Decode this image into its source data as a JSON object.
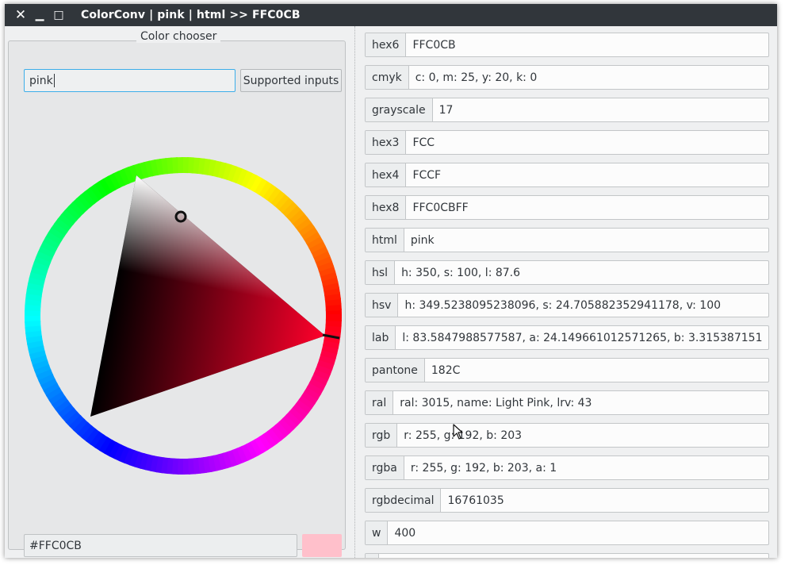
{
  "window": {
    "title": "ColorConv | pink | html >> FFC0CB",
    "close_glyph": "✕",
    "minimize_glyph": "▁",
    "maximize_glyph": "□"
  },
  "chooser": {
    "group_title": "Color chooser",
    "input_value": "pink",
    "supported_inputs_label": "Supported inputs",
    "hex_value": "#FFC0CB",
    "swatch_color": "#FFC0CB",
    "selected_hue_deg": 350
  },
  "formats": [
    {
      "label": "hex6",
      "value": "FFC0CB"
    },
    {
      "label": "cmyk",
      "value": "c: 0, m: 25, y: 20, k: 0"
    },
    {
      "label": "grayscale",
      "value": "17"
    },
    {
      "label": "hex3",
      "value": "FCC"
    },
    {
      "label": "hex4",
      "value": "FCCF"
    },
    {
      "label": "hex8",
      "value": "FFC0CBFF"
    },
    {
      "label": "html",
      "value": "pink"
    },
    {
      "label": "hsl",
      "value": "h: 350, s: 100, l: 87.6"
    },
    {
      "label": "hsv",
      "value": "h: 349.5238095238096, s: 24.705882352941178, v: 100"
    },
    {
      "label": "lab",
      "value": "l: 83.5847988577587, a: 24.149661012571265, b: 3.315387151"
    },
    {
      "label": "pantone",
      "value": "182C"
    },
    {
      "label": "ral",
      "value": "ral: 3015, name: Light Pink, lrv: 43"
    },
    {
      "label": "rgb",
      "value": "r: 255, g: 192, b: 203"
    },
    {
      "label": "rgba",
      "value": "r: 255, g: 192, b: 203, a: 1"
    },
    {
      "label": "rgbdecimal",
      "value": "16761035"
    },
    {
      "label": "w",
      "value": "400"
    },
    {
      "label": "",
      "value": ""
    }
  ]
}
